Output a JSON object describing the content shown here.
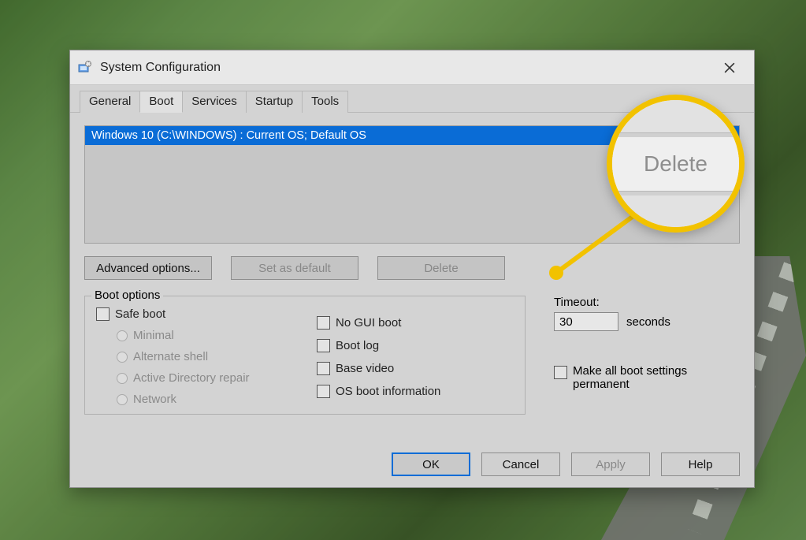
{
  "window": {
    "title": "System Configuration"
  },
  "tabs": {
    "general": "General",
    "boot": "Boot",
    "services": "Services",
    "startup": "Startup",
    "tools": "Tools",
    "active": "Boot"
  },
  "oslist": {
    "entry": "Windows 10 (C:\\WINDOWS) : Current OS; Default OS"
  },
  "buttons": {
    "advanced": "Advanced options...",
    "set_default": "Set as default",
    "delete": "Delete",
    "ok": "OK",
    "cancel": "Cancel",
    "apply": "Apply",
    "help": "Help"
  },
  "boot_options": {
    "legend": "Boot options",
    "safe_boot": "Safe boot",
    "minimal": "Minimal",
    "alternate_shell": "Alternate shell",
    "ad_repair": "Active Directory repair",
    "network": "Network",
    "no_gui": "No GUI boot",
    "boot_log": "Boot log",
    "base_video": "Base video",
    "os_boot_info": "OS boot information"
  },
  "timeout": {
    "label": "Timeout:",
    "value": "30",
    "unit": "seconds"
  },
  "make_permanent": "Make all boot settings permanent",
  "callout": {
    "label": "Delete"
  }
}
